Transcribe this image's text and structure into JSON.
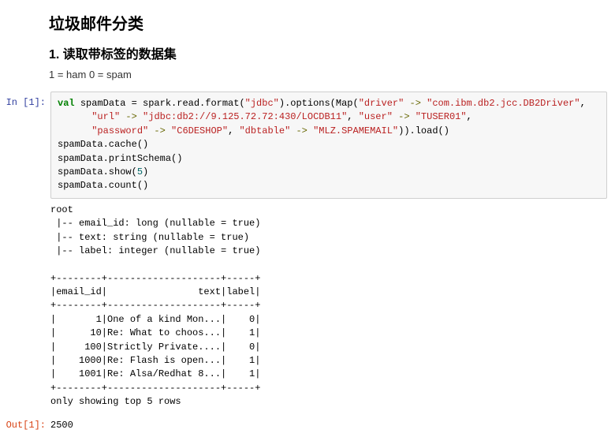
{
  "heading": {
    "title": "垃圾邮件分类",
    "subtitle": "1. 读取带标签的数据集",
    "caption": "1 = ham 0 = spam"
  },
  "cell1": {
    "in_prompt": "In  [1]:",
    "out_prompt": "Out[1]:",
    "code": {
      "kw_val": "val",
      "var": "spamData",
      "eq": " = ",
      "p1a": "spark.read.format(",
      "s1": "\"jdbc\"",
      "p1b": ").options(Map(",
      "s2": "\"driver\"",
      "arrow": " -> ",
      "s3": "\"com.ibm.db2.jcc.DB2Driver\"",
      "l1_tail": ",",
      "s4": "\"url\"",
      "s5": "\"jdbc:db2://9.125.72.72:430/LOCDB11\"",
      "s6": "\"user\"",
      "s7": "\"TUSER01\"",
      "l2_tail": ",",
      "s8": "\"password\"",
      "s9": "\"C6DESHOP\"",
      "s10": "\"dbtable\"",
      "s11": "\"MLZ.SPAMEMAIL\"",
      "l3_tail": ")).load()",
      "l4": "spamData.cache()",
      "l5": "spamData.printSchema()",
      "l6a": "spamData.show(",
      "l6_num": "5",
      "l6b": ")",
      "l7": "spamData.count()"
    },
    "stdout": "root\n |-- email_id: long (nullable = true)\n |-- text: string (nullable = true)\n |-- label: integer (nullable = true)\n\n+--------+--------------------+-----+\n|email_id|                text|label|\n+--------+--------------------+-----+\n|       1|One of a kind Mon...|    0|\n|      10|Re: What to choos...|    1|\n|     100|Strictly Private....|    0|\n|    1000|Re: Flash is open...|    1|\n|    1001|Re: Alsa/Redhat 8...|    1|\n+--------+--------------------+-----+\nonly showing top 5 rows\n",
    "result": "2500"
  },
  "chart_data": {
    "type": "table",
    "title": "spamData.show(5)",
    "columns": [
      "email_id",
      "text",
      "label"
    ],
    "rows": [
      {
        "email_id": 1,
        "text": "One of a kind Mon...",
        "label": 0
      },
      {
        "email_id": 10,
        "text": "Re: What to choos...",
        "label": 1
      },
      {
        "email_id": 100,
        "text": "Strictly Private....",
        "label": 0
      },
      {
        "email_id": 1000,
        "text": "Re: Flash is open...",
        "label": 1
      },
      {
        "email_id": 1001,
        "text": "Re: Alsa/Redhat 8...",
        "label": 1
      }
    ],
    "note": "only showing top 5 rows",
    "schema": [
      {
        "field": "email_id",
        "type": "long",
        "nullable": true
      },
      {
        "field": "text",
        "type": "string",
        "nullable": true
      },
      {
        "field": "label",
        "type": "integer",
        "nullable": true
      }
    ],
    "count": 2500
  }
}
